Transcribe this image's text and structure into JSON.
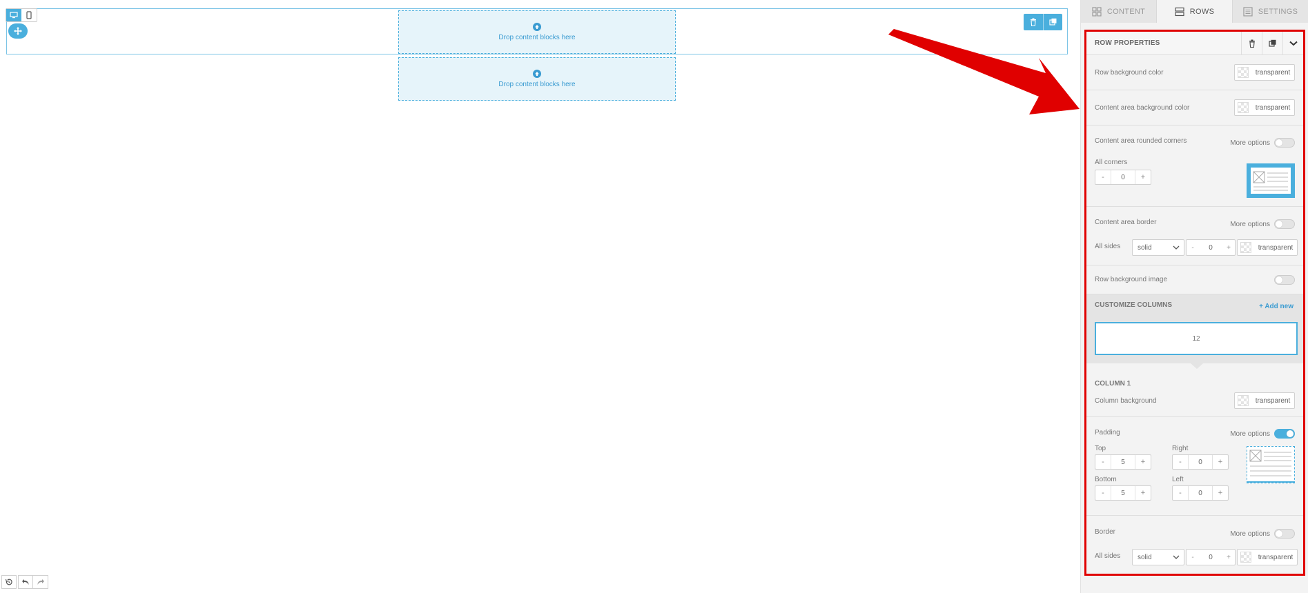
{
  "canvas": {
    "dropzones": [
      {
        "text": "Drop content blocks here"
      },
      {
        "text": "Drop content blocks here"
      }
    ]
  },
  "tabs": [
    {
      "label": "CONTENT",
      "icon": "grid-icon"
    },
    {
      "label": "ROWS",
      "icon": "rows-icon",
      "active": true
    },
    {
      "label": "SETTINGS",
      "icon": "settings-list-icon"
    }
  ],
  "row_properties": {
    "title": "ROW PROPERTIES",
    "row_bg_label": "Row background color",
    "row_bg_value": "transparent",
    "content_bg_label": "Content area background color",
    "content_bg_value": "transparent",
    "rounded_label": "Content area rounded corners",
    "more_options": "More options",
    "all_corners_label": "All corners",
    "all_corners_value": "0",
    "border_label": "Content area border",
    "all_sides_label": "All sides",
    "border_style": "solid",
    "border_width": "0",
    "border_color": "transparent",
    "bg_image_label": "Row background image"
  },
  "columns": {
    "title": "CUSTOMIZE COLUMNS",
    "add_new": "Add new",
    "layout_value": "12"
  },
  "column1": {
    "title": "COLUMN 1",
    "bg_label": "Column background",
    "bg_value": "transparent",
    "padding_label": "Padding",
    "more_options": "More options",
    "top_label": "Top",
    "top_value": "5",
    "right_label": "Right",
    "right_value": "0",
    "bottom_label": "Bottom",
    "bottom_value": "5",
    "left_label": "Left",
    "left_value": "0",
    "border_label": "Border",
    "border_more": "More options",
    "all_sides_label": "All sides",
    "border_style": "solid",
    "border_width": "0",
    "border_color": "transparent"
  },
  "stepper": {
    "minus": "-",
    "plus": "+"
  },
  "colors": {
    "accent": "#4aafdd",
    "annotation": "#e00000"
  }
}
